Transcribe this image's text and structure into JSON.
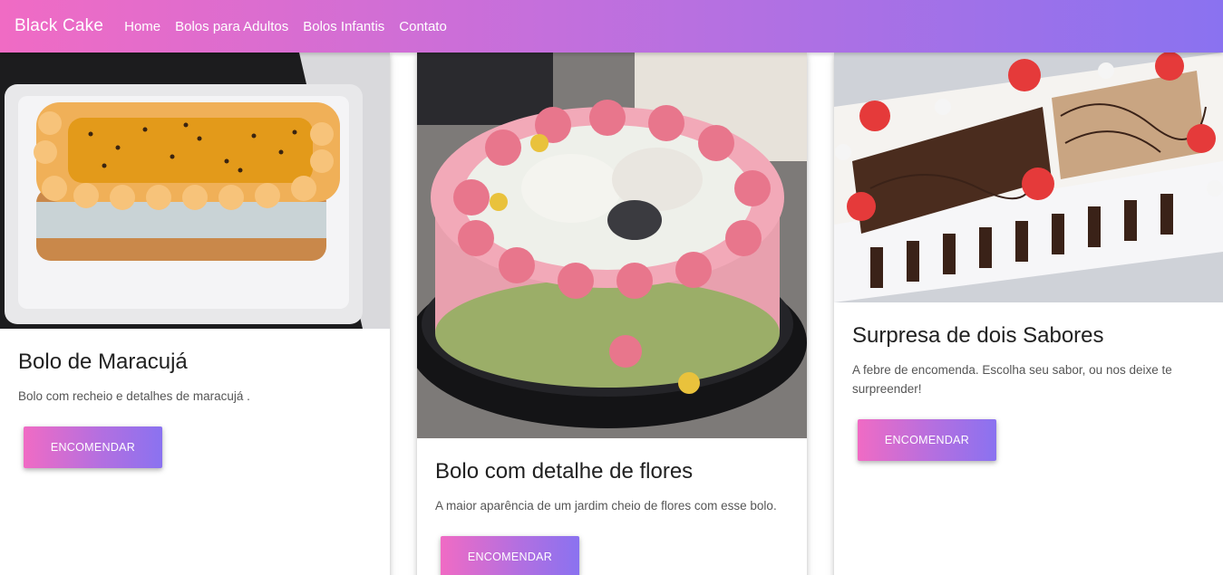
{
  "navbar": {
    "brand": "Black Cake",
    "links": [
      "Home",
      "Bolos para Adultos",
      "Bolos Infantis",
      "Contato"
    ]
  },
  "cards": [
    {
      "image_desc": "passion-fruit-cake-photo",
      "title": "Bolo de Maracujá",
      "text": "Bolo com recheio e detalhes de maracujá .",
      "button": "ENCOMENDAR"
    },
    {
      "image_desc": "flower-cake-photo",
      "title": "Bolo com detalhe de flores",
      "text": "A maior aparência de um jardim cheio de flores com esse bolo.",
      "button": "ENCOMENDAR"
    },
    {
      "image_desc": "strawberry-chocolate-cake-photo",
      "title": "Surpresa de dois Sabores",
      "text": "A febre de encomenda. Escolha seu sabor, ou nos deixe te surpreender!",
      "button": "ENCOMENDAR"
    }
  ],
  "colors": {
    "gradient_start": "#f06bc4",
    "gradient_end": "#8a72f0",
    "nav_text": "#ffffff"
  }
}
